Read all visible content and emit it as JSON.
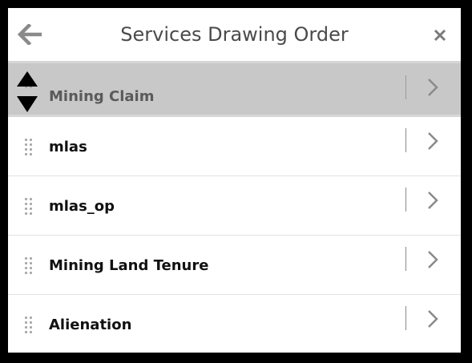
{
  "header": {
    "title": "Services Drawing Order",
    "back_icon": "arrow-left-icon",
    "close_icon": "close-icon"
  },
  "layers": [
    {
      "label": "Mining Claim",
      "state": "dragging"
    },
    {
      "label": "mlas"
    },
    {
      "label": "mlas_op"
    },
    {
      "label": "Mining Land Tenure"
    },
    {
      "label": "Alienation"
    }
  ],
  "icons": {
    "drag_handle": "grip-dots-icon",
    "reorder": "reorder-arrows-icon",
    "detail": "chevron-right-icon"
  },
  "colors": {
    "frame_border": "#000000",
    "dragging_row": "#c8c8c8",
    "title_text": "#4a4a4a",
    "icon_gray": "#8a8a8a"
  }
}
